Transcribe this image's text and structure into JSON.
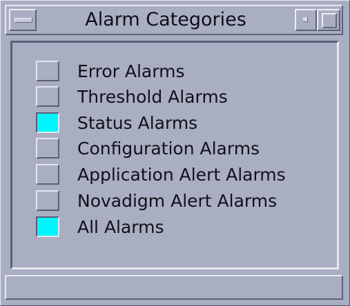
{
  "window": {
    "title": "Alarm Categories"
  },
  "categories": [
    {
      "label": "Error Alarms",
      "checked": false
    },
    {
      "label": "Threshold Alarms",
      "checked": false
    },
    {
      "label": "Status Alarms",
      "checked": true
    },
    {
      "label": "Configuration Alarms",
      "checked": false
    },
    {
      "label": "Application Alert Alarms",
      "checked": false
    },
    {
      "label": "Novadigm Alert Alarms",
      "checked": false
    },
    {
      "label": "All Alarms",
      "checked": true
    }
  ],
  "colors": {
    "background": "#a9aec2",
    "checked": "#00f5ff"
  }
}
